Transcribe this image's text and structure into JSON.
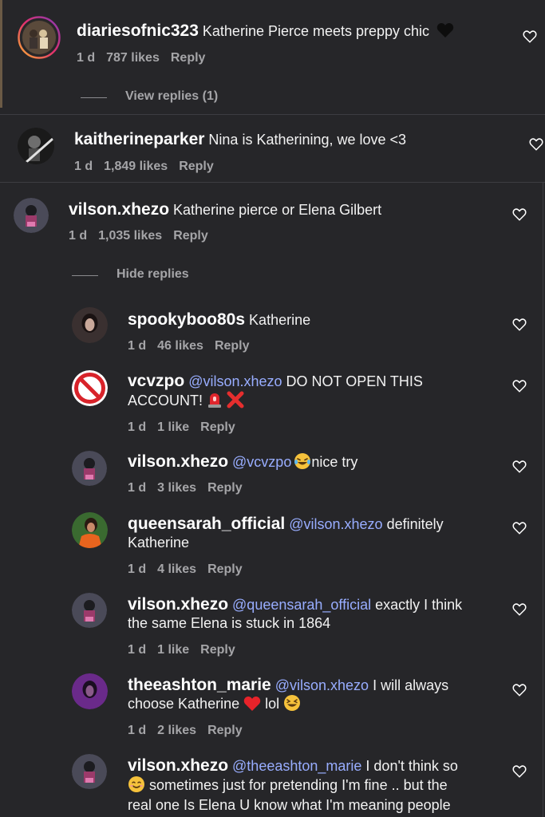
{
  "comments": [
    {
      "username": "diariesofnic323",
      "text": "Katherine Pierce meets preppy chic",
      "emoji": "black-heart",
      "time": "1 d",
      "likes": "787 likes",
      "reply": "Reply",
      "thread_toggle": "View replies (1)"
    },
    {
      "username": "kaitherineparker",
      "text": "Nina is Katherining, we love <3",
      "time": "1 d",
      "likes": "1,849 likes",
      "reply": "Reply"
    },
    {
      "username": "vilson.xhezo",
      "text": "Katherine pierce or Elena Gilbert",
      "time": "1 d",
      "likes": "1,035 likes",
      "reply": "Reply",
      "thread_toggle": "Hide replies",
      "replies": [
        {
          "username": "spookyboo80s",
          "text": "Katherine",
          "time": "1 d",
          "likes": "46 likes",
          "reply": "Reply"
        },
        {
          "username": "vcvzpo",
          "mention": "@vilson.xhezo",
          "text_line1": "DO NOT OPEN THIS",
          "text_line2": "ACCOUNT!",
          "emoji": [
            "siren",
            "cross-mark"
          ],
          "time": "1 d",
          "likes": "1 like",
          "reply": "Reply"
        },
        {
          "username": "vilson.xhezo",
          "mention": "@vcvzpo",
          "emoji": "tears-of-joy",
          "text": "nice try",
          "time": "1 d",
          "likes": "3 likes",
          "reply": "Reply"
        },
        {
          "username": "queensarah_official",
          "mention": "@vilson.xhezo",
          "text_line1": "definitely",
          "text_line2": "Katherine",
          "time": "1 d",
          "likes": "4 likes",
          "reply": "Reply"
        },
        {
          "username": "vilson.xhezo",
          "mention": "@queensarah_official",
          "text_line1": "exactly I think",
          "text_line2": "the same Elena is stuck in 1864",
          "time": "1 d",
          "likes": "1 like",
          "reply": "Reply"
        },
        {
          "username": "theeashton_marie",
          "mention": "@vilson.xhezo",
          "text_line1": "I will always",
          "text_line2a": "choose Katherine",
          "text_line2b": "lol",
          "emoji": [
            "red-heart",
            "grinning-squinting"
          ],
          "time": "1 d",
          "likes": "2 likes",
          "reply": "Reply"
        },
        {
          "username": "vilson.xhezo",
          "mention": "@theeashton_marie",
          "text_line1": "I don't think so",
          "text_line2": "sometimes just for pretending I'm fine .. but the",
          "text_line3": "real one Is Elena U know what I'm meaning people",
          "emoji": "smiling-face"
        }
      ]
    }
  ],
  "icons": {
    "heart": "heart-outline-icon",
    "blocked_avatar": "prohibited-icon"
  },
  "colors": {
    "background": "#262629",
    "mention": "#98adff",
    "meta": "#a5a5a8"
  }
}
